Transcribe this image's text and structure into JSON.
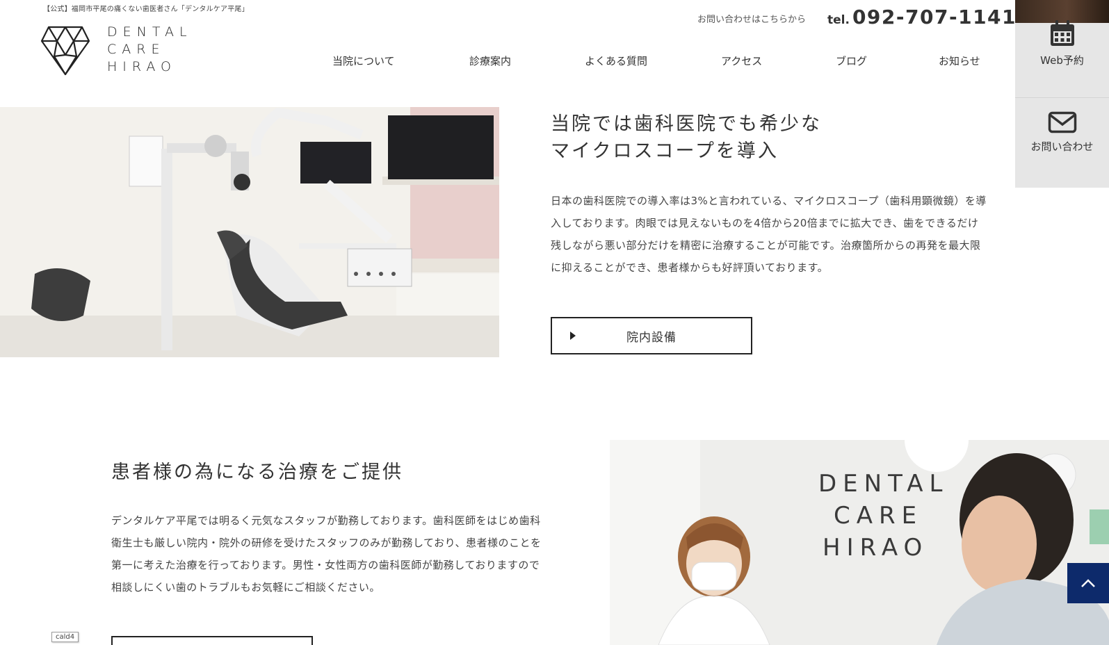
{
  "header": {
    "tagline": "【公式】福岡市平尾の痛くない歯医者さん「デンタルケア平尾」",
    "logo_lines": [
      "DENTAL",
      "CARE",
      "HIRAO"
    ],
    "contact_text": "お問い合わせはこちらから",
    "tel_prefix": "tel.",
    "tel_number": "092-707-1141"
  },
  "nav": {
    "items": [
      {
        "label": "当院について"
      },
      {
        "label": "診療案内"
      },
      {
        "label": "よくある質問"
      },
      {
        "label": "アクセス"
      },
      {
        "label": "ブログ"
      },
      {
        "label": "お知らせ"
      }
    ]
  },
  "side": {
    "web_reserve": "Web予約",
    "contact": "お問い合わせ"
  },
  "section1": {
    "title_line1": "当院では歯科医院でも希少な",
    "title_line2": "マイクロスコープを導入",
    "body": [
      "日本の歯科医院での導入率は3%と言われている、マイクロスコープ（歯科用顕微鏡）を導",
      "入しております。肉眼では見えないものを4倍から20倍までに拡大でき、歯をできるだけ",
      "残しながら悪い部分だけを精密に治療することが可能です。治療箇所からの再発を最大限",
      "に抑えることができ、患者様からも好評頂いております。"
    ],
    "cta_label": "院内設備"
  },
  "section2": {
    "title": "患者様の為になる治療をご提供",
    "body": [
      "デンタルケア平尾では明るく元気なスタッフが勤務しております。歯科医師をはじめ歯科",
      "衛生士も厳しい院内・院外の研修を受けたスタッフのみが勤務しており、患者様のことを",
      "第一に考えた治療を行っております。男性・女性両方の歯科医師が勤務しておりますので",
      "相談しにくい歯のトラブルもお気軽にご相談ください。"
    ],
    "photo_sign": [
      "DENTAL",
      "CARE",
      "HIRAO"
    ]
  },
  "debug_label": "cald4",
  "colors": {
    "accent_navy": "#0d2a6b",
    "side_panel": "#e6e6e6",
    "text": "#333333"
  }
}
